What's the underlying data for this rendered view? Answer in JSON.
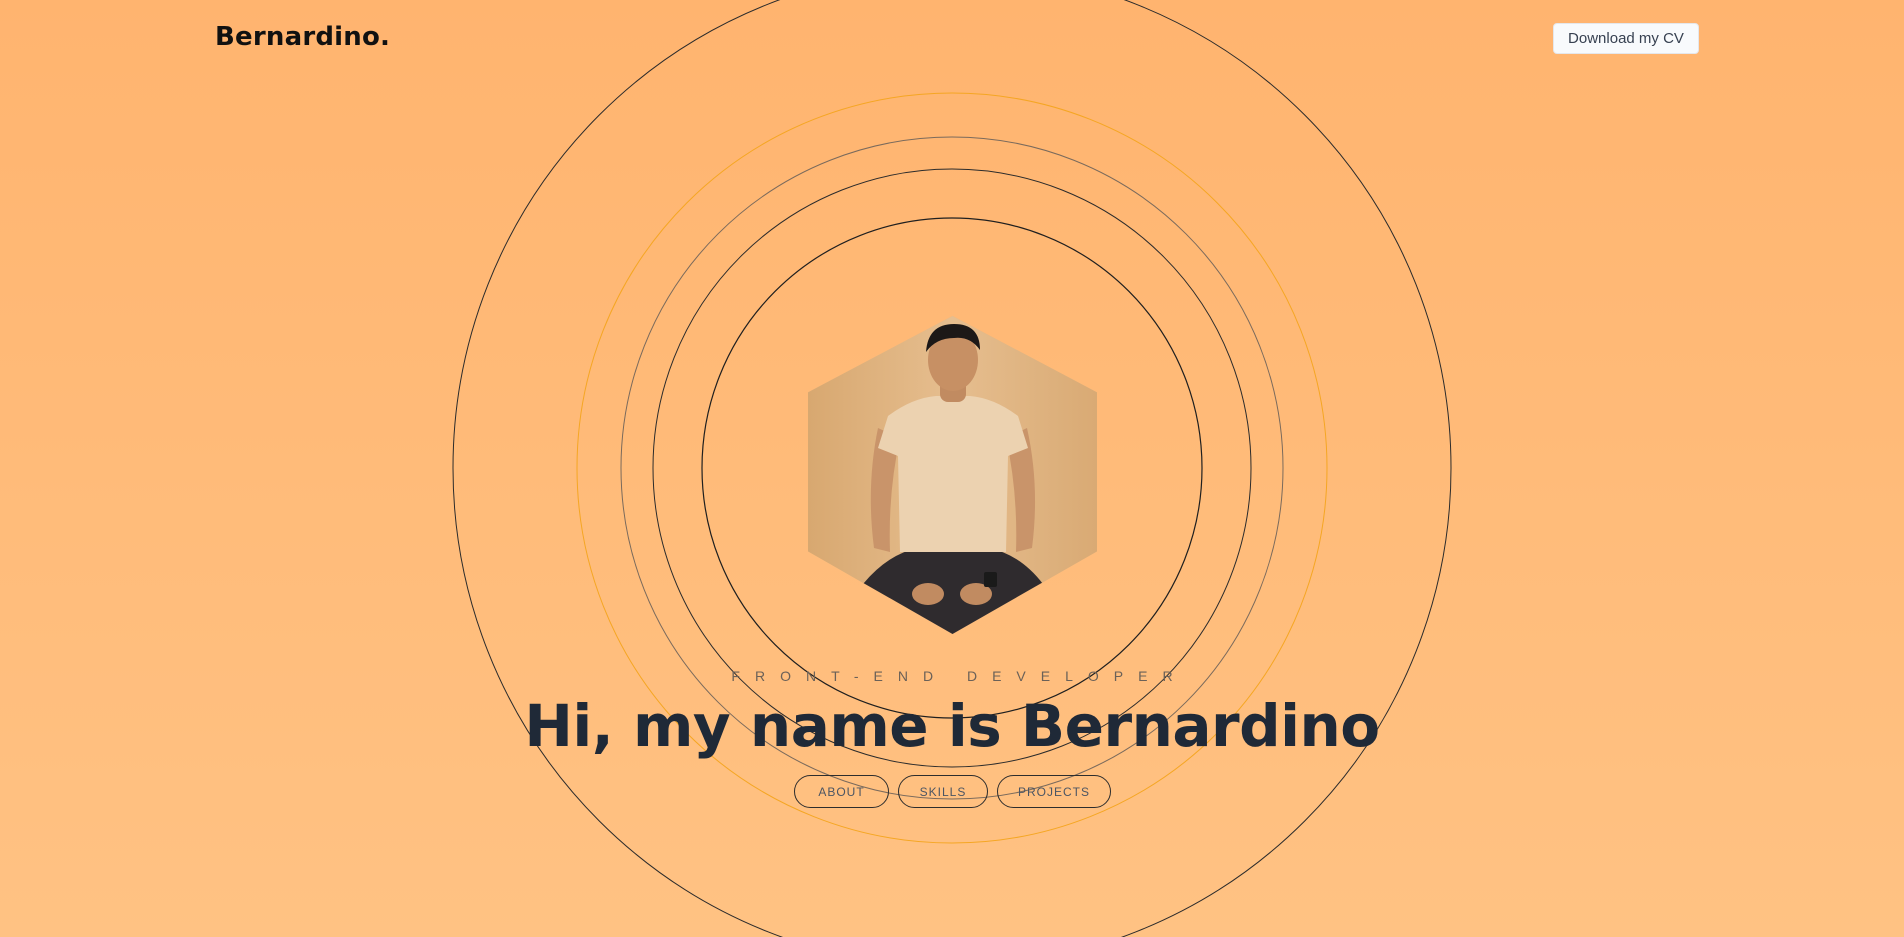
{
  "header": {
    "logo": "Bernardino.",
    "cv_button_label": "Download my CV"
  },
  "hero": {
    "subtitle": "FRONT-END DEVELOPER",
    "headline": "Hi, my name is Bernardino",
    "nav_items": [
      {
        "label": "ABOUT"
      },
      {
        "label": "SKILLS"
      },
      {
        "label": "PROJECTS"
      }
    ]
  },
  "colors": {
    "background_top": "#ffb46f",
    "background_bottom": "#ffc283",
    "ring_dark": "#2b2b2b",
    "ring_accent": "#f5a623",
    "text_primary": "#1f2937"
  }
}
